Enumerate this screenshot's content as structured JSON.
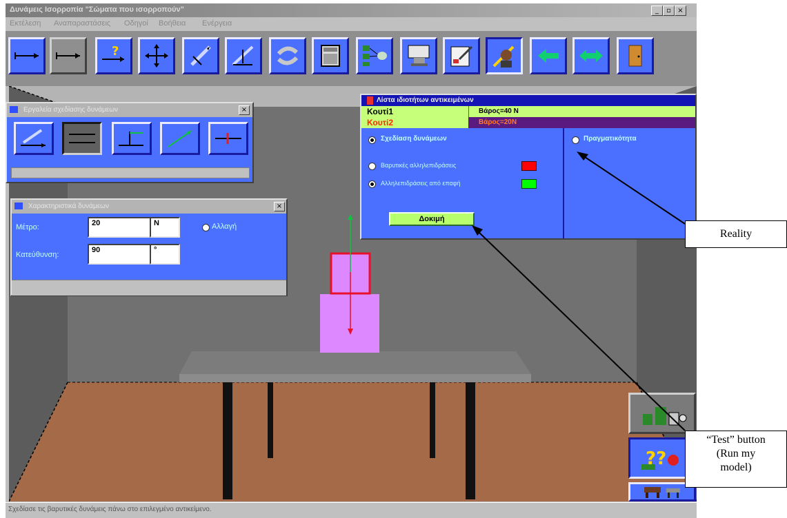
{
  "window": {
    "title": "Δυνάμεις Ισορροπία \"Σώματα που ισορροπούν\"",
    "controls": [
      "_",
      "▫",
      "×"
    ]
  },
  "menu": [
    "Εκτέλεση",
    "Αναπαραστάσεις",
    "Οδηγοί",
    "Βοήθεια",
    "Ενέργεια"
  ],
  "toolbar": {
    "buttons": [
      {
        "icon": "vector-line-icon"
      },
      {
        "icon": "vector-line-gray-icon"
      },
      {
        "icon": "vector-help-icon"
      },
      {
        "icon": "move-arrows-icon"
      },
      {
        "icon": "edit-vector-icon"
      },
      {
        "icon": "pencil-angle-icon"
      },
      {
        "icon": "cycle-arrows-icon"
      },
      {
        "icon": "calculator-icon"
      },
      {
        "icon": "connect-objects-icon"
      },
      {
        "icon": "presentation-icon"
      },
      {
        "icon": "notebook-icon"
      },
      {
        "icon": "teacher-icon"
      },
      {
        "icon": "back-arrow-icon"
      },
      {
        "icon": "double-arrow-icon"
      },
      {
        "icon": "exit-door-icon"
      }
    ]
  },
  "toolbox_panel": {
    "title": "Εργαλεία σχεδίασης δυνάμεων",
    "close": "×",
    "tools": [
      "draw-vector-icon",
      "parallel-lines-icon",
      "perpendicular-icon",
      "diagonal-vector-icon",
      "red-vector-icon"
    ]
  },
  "properties_panel": {
    "title": "Χαρακτηριστικά δυνάμεων",
    "close": "×",
    "magnitude_label": "Μέτρο:",
    "magnitude_value": "20",
    "magnitude_unit": "N",
    "direction_label": "Κατεύθυνση:",
    "direction_value": "90",
    "direction_unit": "°",
    "change_label": "Αλλαγή"
  },
  "object_list_panel": {
    "title": "Λίστα ιδιοτήτων αντικειμένων",
    "rows": [
      {
        "name": "Κουτί1",
        "value": "Βάρος=40 Ν"
      },
      {
        "name": "Κουτί2",
        "value": "Βάρος=20Ν"
      }
    ],
    "draw_forces_label": "Σχεδίαση δυνάμεων",
    "gravity_label": "Βαρυτικές αλληλεπιδράσεις",
    "contact_label": "Αλληλεπιδράσεις από επαφή",
    "test_button": "Δοκιμή",
    "reality_label": "Πραγματικότητα",
    "colors": {
      "gravity": "#ff0000",
      "contact": "#00ff00"
    }
  },
  "status_text": "Σχεδίασε τις βαρυτικές δυνάμεις πάνω στο επιλεγμένο αντικείμενο.",
  "callouts": {
    "reality": "Reality",
    "test_line1": "“Test” button",
    "test_line2": "(Run my",
    "test_line3": "model)"
  }
}
